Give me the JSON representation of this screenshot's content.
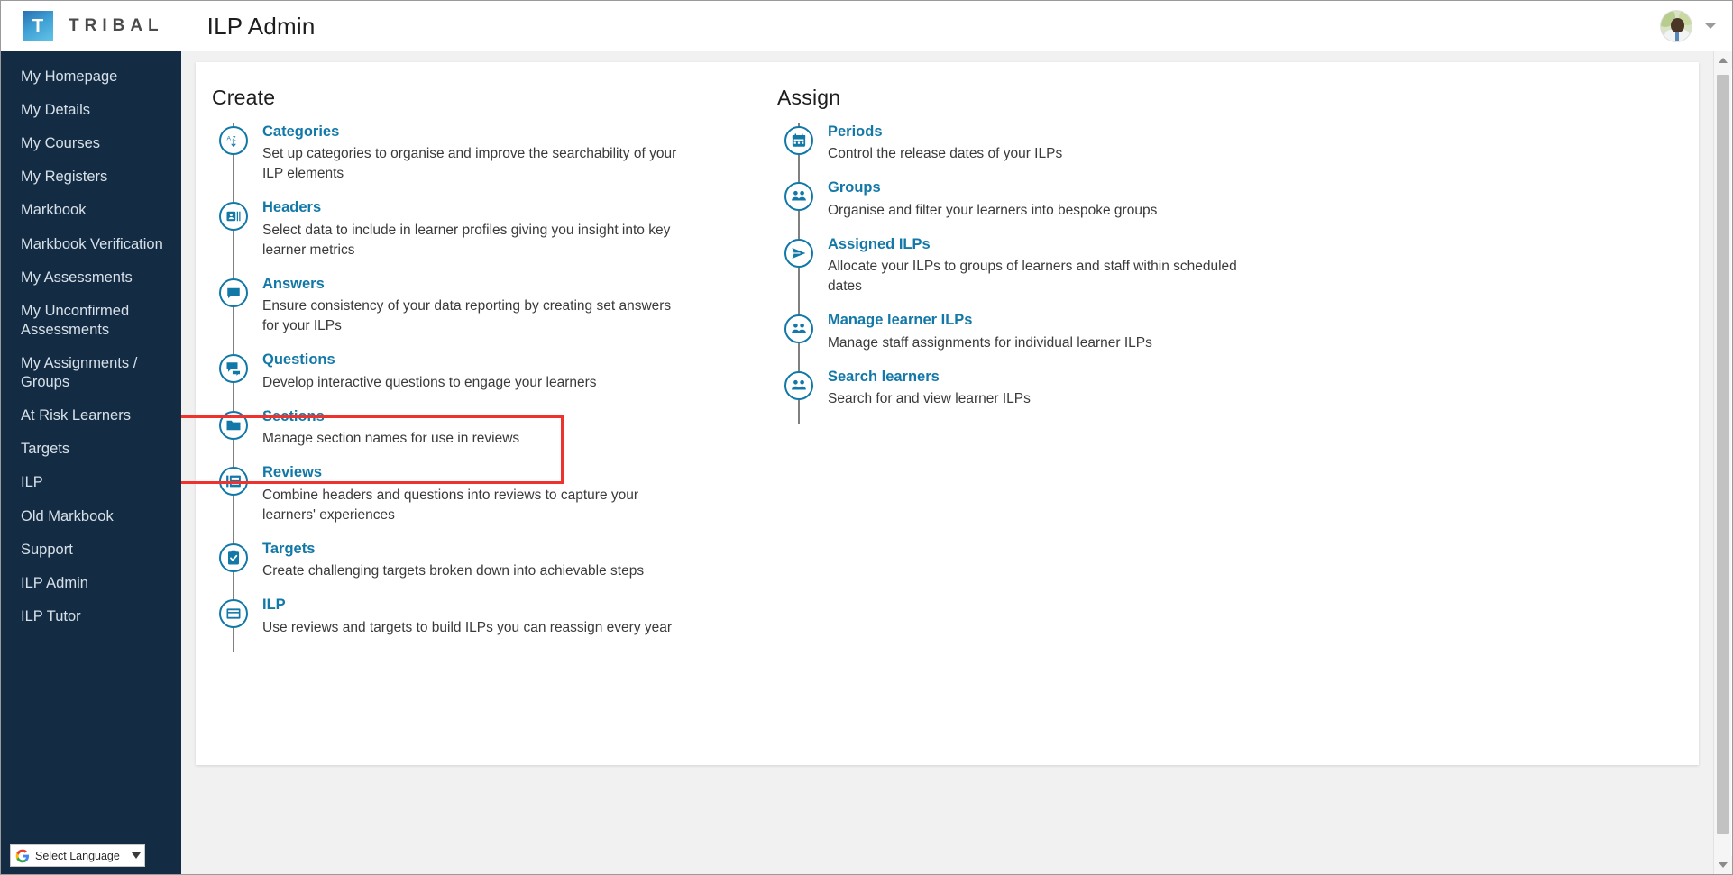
{
  "brand": {
    "logo_letter": "T",
    "logo_word": "TRIBAL",
    "accent_blue": "#1278a8",
    "sidebar_bg": "#132c44",
    "highlight_color": "#f0322e"
  },
  "header": {
    "page_title": "ILP Admin",
    "avatar_name": "user-avatar",
    "account_caret": "chevron-down-icon"
  },
  "sidebar": {
    "items": [
      {
        "label": "My Homepage"
      },
      {
        "label": "My Details"
      },
      {
        "label": "My Courses"
      },
      {
        "label": "My Registers"
      },
      {
        "label": "Markbook"
      },
      {
        "label": "Markbook Verification"
      },
      {
        "label": "My Assessments"
      },
      {
        "label": "My Unconfirmed Assessments"
      },
      {
        "label": "My Assignments / Groups"
      },
      {
        "label": "At Risk Learners"
      },
      {
        "label": "Targets"
      },
      {
        "label": "ILP"
      },
      {
        "label": "Old Markbook"
      },
      {
        "label": "Support"
      },
      {
        "label": "ILP Admin"
      },
      {
        "label": "ILP Tutor"
      }
    ],
    "language_widget": {
      "label": "Select Language",
      "caret": "▼",
      "icon": "google-g-icon"
    }
  },
  "main": {
    "create": {
      "heading": "Create",
      "items": [
        {
          "icon": "sort-alpha-icon",
          "title": "Categories",
          "desc": "Set up categories to organise and improve the searchability of your ILP elements"
        },
        {
          "icon": "id-card-icon",
          "title": "Headers",
          "desc": "Select data to include in learner profiles giving you insight into key learner metrics"
        },
        {
          "icon": "speech-bubble-icon",
          "title": "Answers",
          "desc": "Ensure consistency of your data reporting by creating set answers for your ILPs"
        },
        {
          "icon": "chat-bubbles-icon",
          "title": "Questions",
          "desc": "Develop interactive questions to engage your learners"
        },
        {
          "icon": "folder-icon",
          "title": "Sections",
          "desc": "Manage section names for use in reviews"
        },
        {
          "icon": "document-list-icon",
          "title": "Reviews",
          "desc": "Combine headers and questions into reviews to capture your learners' experiences",
          "highlighted": true
        },
        {
          "icon": "clipboard-check-icon",
          "title": "Targets",
          "desc": "Create challenging targets broken down into achievable steps"
        },
        {
          "icon": "window-panel-icon",
          "title": "ILP",
          "desc": "Use reviews and targets to build ILPs you can reassign every year"
        }
      ]
    },
    "assign": {
      "heading": "Assign",
      "items": [
        {
          "icon": "calendar-icon",
          "title": "Periods",
          "desc": "Control the release dates of your ILPs"
        },
        {
          "icon": "people-icon",
          "title": "Groups",
          "desc": "Organise and filter your learners into bespoke groups"
        },
        {
          "icon": "paper-plane-icon",
          "title": "Assigned ILPs",
          "desc": "Allocate your ILPs to groups of learners and staff within scheduled dates"
        },
        {
          "icon": "people-icon",
          "title": "Manage learner ILPs",
          "desc": "Manage staff assignments for individual learner ILPs"
        },
        {
          "icon": "people-icon",
          "title": "Search learners",
          "desc": "Search for and view learner ILPs"
        }
      ]
    }
  },
  "scrollbar": {
    "up_arrow": "scroll-up-arrow",
    "down_arrow": "scroll-down-arrow"
  }
}
